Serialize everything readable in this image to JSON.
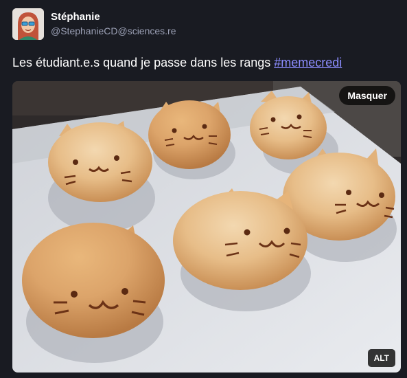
{
  "author": {
    "display_name": "Stéphanie",
    "handle": "@StephanieCD@sciences.re",
    "avatar_icon": "avatar-illustration"
  },
  "status": {
    "text": "Les étudiant.e.s quand je passe dans les rangs ",
    "hashtag": "#memecredi"
  },
  "media": {
    "description": "photo of cat-shaped bread buns on baking paper",
    "hide_label": "Masquer",
    "alt_label": "ALT"
  },
  "colors": {
    "background": "#191b22",
    "hashtag": "#8c8dff",
    "handle": "#9ba0b5"
  }
}
